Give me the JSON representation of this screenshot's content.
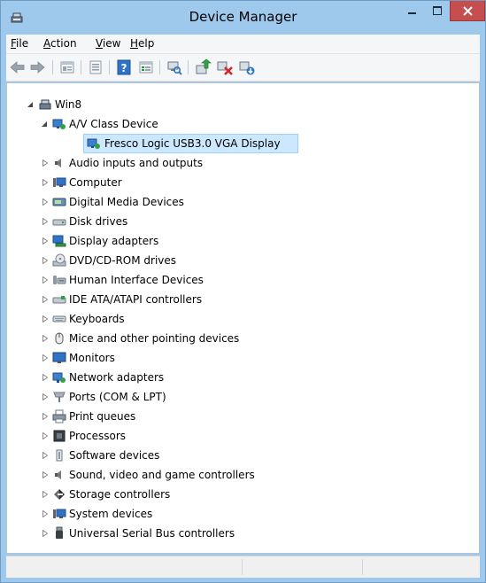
{
  "window": {
    "title": "Device Manager"
  },
  "colors": {
    "frame": "#9ec8ec",
    "close_button": "#c74e4e",
    "selection": "#cce8ff"
  },
  "menu": [
    {
      "accel": "F",
      "rest": "ile"
    },
    {
      "accel": "A",
      "rest": "ction"
    },
    {
      "accel": "V",
      "rest": "iew"
    },
    {
      "accel": "H",
      "rest": "elp"
    }
  ],
  "toolbar": [
    "back-arrow-icon",
    "forward-arrow-icon",
    "properties-icon",
    "view-icon",
    "help-icon",
    "view-details-icon",
    "scan-hardware-icon",
    "update-driver-icon",
    "disable-device-icon",
    "uninstall-device-icon"
  ],
  "tree": {
    "root": "Win8",
    "expanded": "A/V Class Device",
    "selected_child": "Fresco Logic USB3.0 VGA Display",
    "categories": [
      "Audio inputs and outputs",
      "Computer",
      "Digital Media Devices",
      "Disk drives",
      "Display adapters",
      "DVD/CD-ROM drives",
      "Human Interface Devices",
      "IDE ATA/ATAPI controllers",
      "Keyboards",
      "Mice and other pointing devices",
      "Monitors",
      "Network adapters",
      "Ports (COM & LPT)",
      "Print queues",
      "Processors",
      "Software devices",
      "Sound, video and game controllers",
      "Storage controllers",
      "System devices",
      "Universal Serial Bus controllers"
    ]
  }
}
